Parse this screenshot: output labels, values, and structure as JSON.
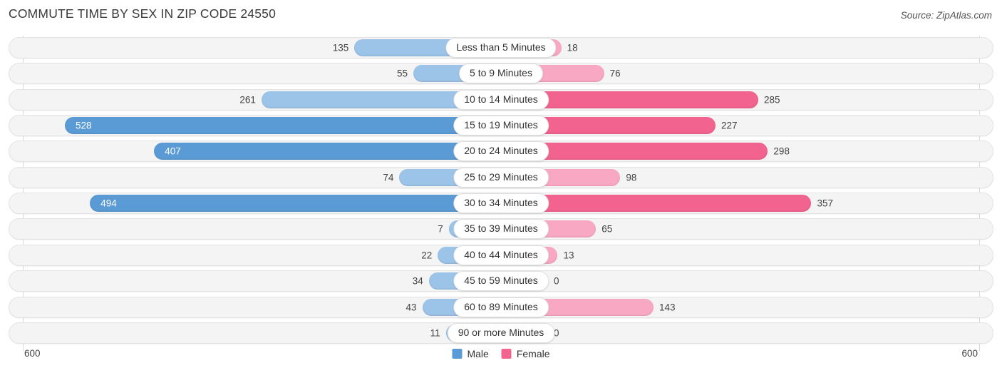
{
  "header": {
    "title": "COMMUTE TIME BY SEX IN ZIP CODE 24550",
    "source": "Source: ZipAtlas.com"
  },
  "axis": {
    "left_label": "600",
    "right_label": "600"
  },
  "legend": {
    "items": [
      {
        "label": "Male",
        "color": "#5b9bd5"
      },
      {
        "label": "Female",
        "color": "#f2638f"
      }
    ]
  },
  "chart_data": {
    "type": "bar",
    "title": "COMMUTE TIME BY SEX IN ZIP CODE 24550",
    "subtitle": "",
    "orientation": "horizontal-diverging",
    "xlabel": "",
    "ylabel": "",
    "xlim": [
      600,
      600
    ],
    "grid": true,
    "legend_position": "bottom-center",
    "categories": [
      "Less than 5 Minutes",
      "5 to 9 Minutes",
      "10 to 14 Minutes",
      "15 to 19 Minutes",
      "20 to 24 Minutes",
      "25 to 29 Minutes",
      "30 to 34 Minutes",
      "35 to 39 Minutes",
      "40 to 44 Minutes",
      "45 to 59 Minutes",
      "60 to 89 Minutes",
      "90 or more Minutes"
    ],
    "series": [
      {
        "name": "Male",
        "color": "#5b9bd5",
        "values": [
          135,
          55,
          261,
          528,
          407,
          74,
          494,
          7,
          22,
          34,
          43,
          11
        ]
      },
      {
        "name": "Female",
        "color": "#f2638f",
        "values": [
          18,
          76,
          285,
          227,
          298,
          98,
          357,
          65,
          13,
          0,
          143,
          0
        ]
      }
    ]
  }
}
